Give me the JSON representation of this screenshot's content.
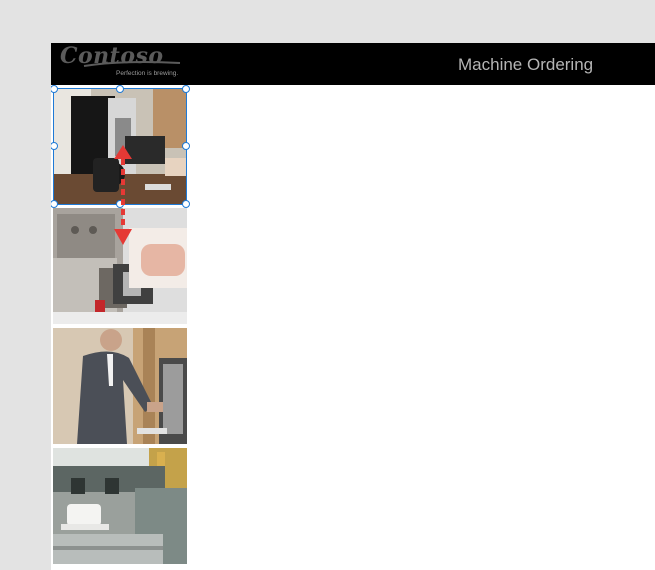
{
  "header": {
    "logo_text": "Contoso",
    "logo_tagline": "Perfection is brewing.",
    "title": "Machine Ordering"
  },
  "gallery": {
    "items": [
      {
        "name": "coffee-machine-image-1",
        "selected": true
      },
      {
        "name": "coffee-machine-image-2",
        "selected": false
      },
      {
        "name": "coffee-machine-image-3",
        "selected": false
      },
      {
        "name": "coffee-machine-image-4",
        "selected": false
      }
    ]
  },
  "colors": {
    "header_bg": "#000000",
    "selection": "#1f7ad6",
    "reorder_arrow": "#e53935",
    "workspace_bg": "#e3e3e3"
  },
  "icons": {
    "reorder": "reorder-arrows-icon"
  }
}
